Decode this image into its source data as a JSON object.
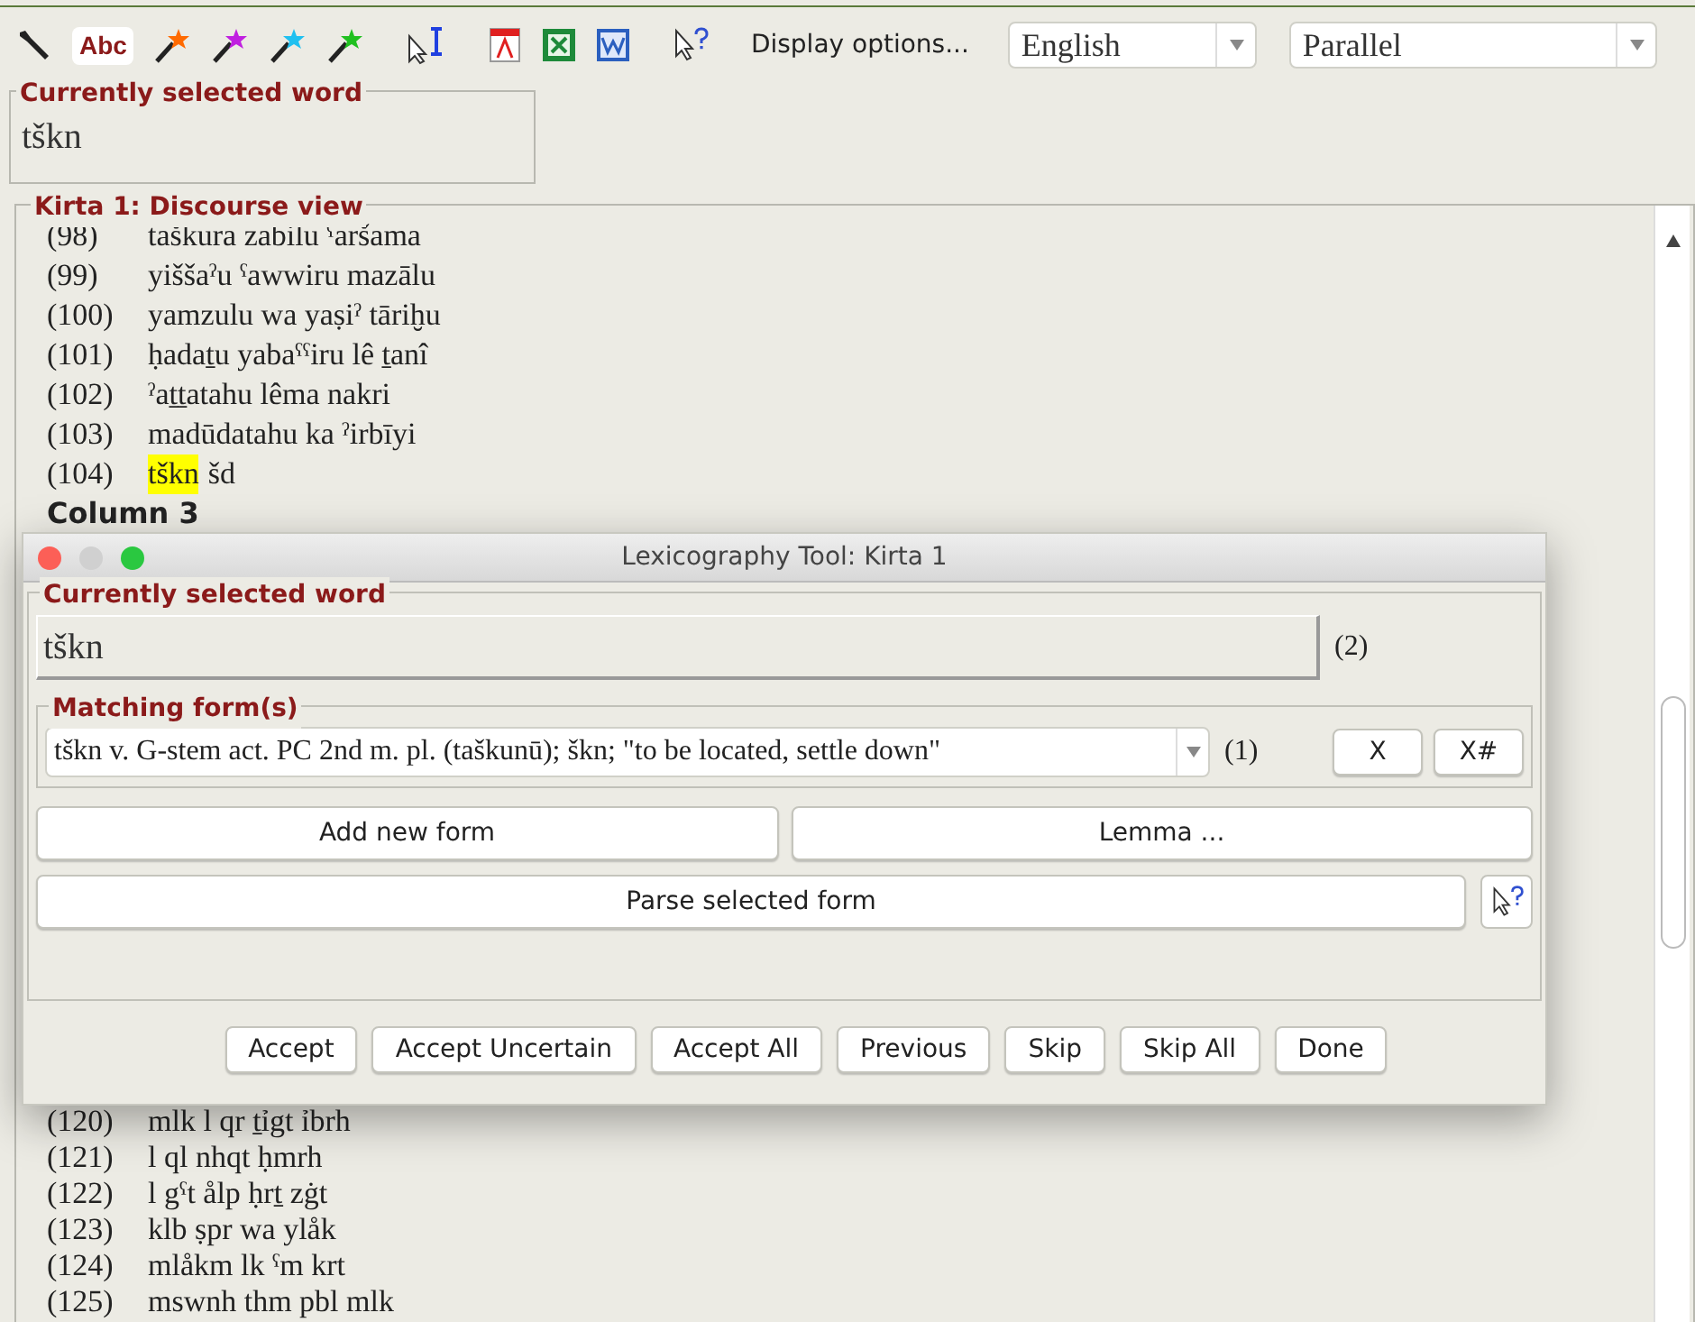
{
  "toolbar": {
    "spell_label": "Abc",
    "wands": [
      {
        "color": "#ff6a00"
      },
      {
        "color": "#c020e0"
      },
      {
        "color": "#20c0f0"
      },
      {
        "color": "#20c020"
      }
    ],
    "display_options": "Display options...",
    "language": "English",
    "layout": "Parallel"
  },
  "selected_word": {
    "title": "Currently selected word",
    "value": "tškn"
  },
  "discourse": {
    "title": "Kirta 1: Discourse view",
    "lines": [
      {
        "kind": "line",
        "number": "(98)",
        "text": "taškura zabilu ˤaršama"
      },
      {
        "kind": "line",
        "number": "(99)",
        "text": "yiššaˀu ˤawwiru mazālu"
      },
      {
        "kind": "line",
        "number": "(100)",
        "text": "yamzulu wa yaṣiˀ tāriḫu"
      },
      {
        "kind": "line",
        "number": "(101)",
        "text": "ḥadaṯu yabaˤˤiru lê ṯanî"
      },
      {
        "kind": "line",
        "number": "(102)",
        "text": "ˀaṯṯatahu lêma nakri"
      },
      {
        "kind": "line",
        "number": "(103)",
        "text": "madūdatahu ka ˀirbīyi"
      },
      {
        "kind": "line",
        "number": "(104)",
        "highlight": "tškn",
        "text": "šd"
      },
      {
        "kind": "heading",
        "text": "Column 3"
      }
    ],
    "lines_below": [
      {
        "kind": "line",
        "number": "(120)",
        "text": "mlk l qr ṯỉgt ỉbrh"
      },
      {
        "kind": "line",
        "number": "(121)",
        "text": "l ql nhqt ḥmrh"
      },
      {
        "kind": "line",
        "number": "(122)",
        "text": "l gˤt ålp ḥrṯ zġt"
      },
      {
        "kind": "line",
        "number": "(123)",
        "text": "klb ṣpr wa ylåk"
      },
      {
        "kind": "line",
        "number": "(124)",
        "text": "mlåkm lk ˤm krt"
      },
      {
        "kind": "line",
        "number": "(125)",
        "text": "mswnh thm pbl mlk"
      }
    ]
  },
  "dialog": {
    "title": "Lexicography Tool: Kirta 1",
    "word_group": "Currently selected word",
    "word": "tškn",
    "word_count": "(2)",
    "forms_group": "Matching form(s)",
    "form": "tškn v. G-stem act. PC 2nd m. pl. (taškunū); škn; \"to be located, settle down\"",
    "form_count": "(1)",
    "clear_buttons": [
      "X",
      "X#"
    ],
    "add_button": "Add new form",
    "lemma_button": "Lemma ...",
    "parse_button": "Parse selected form",
    "actions": [
      "Accept",
      "Accept Uncertain",
      "Accept All",
      "Previous",
      "Skip",
      "Skip All",
      "Done"
    ]
  }
}
